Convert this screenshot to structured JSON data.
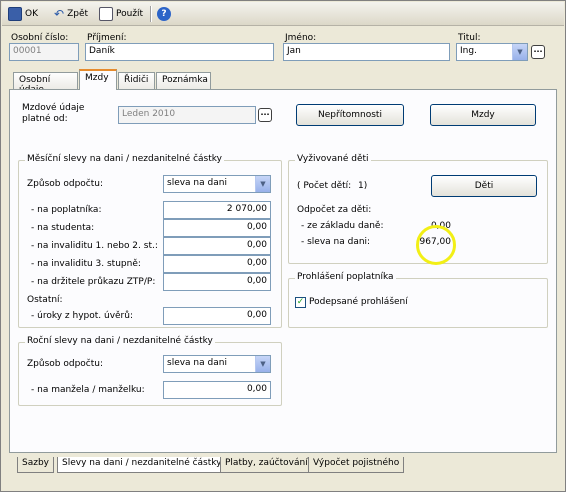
{
  "toolbar": {
    "ok": "OK",
    "back": "Zpět",
    "use": "Použít",
    "help": "?"
  },
  "header": {
    "osobni_cislo_label": "Osobní číslo:",
    "osobni_cislo": "00001",
    "prijmeni_label": "Příjmení:",
    "prijmeni": "Daník",
    "jmeno_label": "Jméno:",
    "jmeno": "Jan",
    "titul_label": "Titul:",
    "titul": "Ing."
  },
  "tabs": [
    "Osobní údaje",
    "Mzdy",
    "Řidiči",
    "Poznámka"
  ],
  "mzdove": {
    "label_line1": "Mzdové údaje",
    "label_line2": "platné od:",
    "value": "Leden 2010",
    "nepritomnosti": "Nepřítomnosti",
    "mzdy": "Mzdy"
  },
  "mesicni": {
    "title": "Měsíční slevy na dani / nezdanitelné částky",
    "zpusob_label": "Způsob odpočtu:",
    "zpusob_value": "sleva na dani",
    "rows": [
      {
        "label": "- na poplatníka:",
        "value": "2 070,00"
      },
      {
        "label": "- na studenta:",
        "value": "0,00"
      },
      {
        "label": "- na invaliditu 1. nebo 2. st.:",
        "value": "0,00"
      },
      {
        "label": "- na invaliditu 3. stupně:",
        "value": "0,00"
      },
      {
        "label": "- na držitele průkazu ZTP/P:",
        "value": "0,00"
      }
    ],
    "ostatni_label": "Ostatní:",
    "uroky_label": "- úroky z hypot. úvěrů:",
    "uroky_value": "0,00"
  },
  "rocni": {
    "title": "Roční slevy na dani / nezdanitelné částky",
    "zpusob_label": "Způsob odpočtu:",
    "zpusob_value": "sleva na dani",
    "manzel_label": "- na manžela / manželku:",
    "manzel_value": "0,00"
  },
  "deti": {
    "title": "Vyživované děti",
    "pocet_label": "( Počet dětí:",
    "pocet_value": "1)",
    "deti_button": "Děti",
    "odpocet_label": "Odpočet za děti:",
    "zaklad_label": "- ze základu daně:",
    "zaklad_value": "0,00",
    "sleva_label": "- sleva na dani:",
    "sleva_value": "967,00"
  },
  "prohlaseni": {
    "title": "Prohlášení poplatníka",
    "checkbox_label": "Podepsané prohlášení",
    "checked": true
  },
  "bottom_tabs": [
    "Sazby",
    "Slevy na dani / nezdanitelné částky",
    "Platby, zaúčtování",
    "Výpočet pojistného"
  ]
}
